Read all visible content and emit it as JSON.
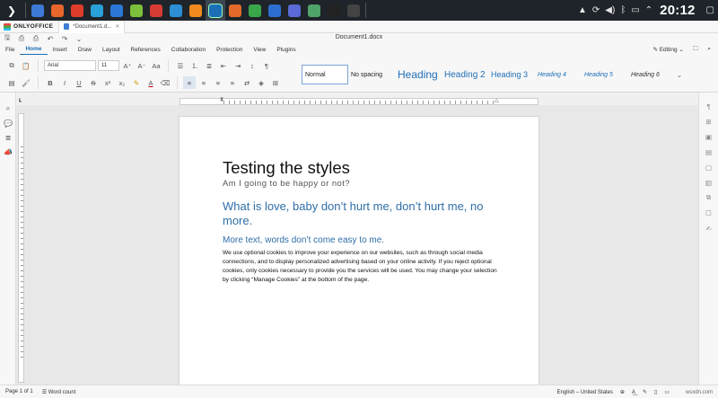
{
  "taskbar": {
    "start_icon": "kde-start-icon",
    "apps": [
      {
        "name": "folder-app",
        "color": "#3d7ad6",
        "active": false
      },
      {
        "name": "firefox-app",
        "color": "#e8652b",
        "active": false
      },
      {
        "name": "brave-app",
        "color": "#e03c2c",
        "active": false
      },
      {
        "name": "edge-app",
        "color": "#2aa0d8",
        "active": false
      },
      {
        "name": "chromium-app",
        "color": "#2b78d6",
        "active": false
      },
      {
        "name": "android-app",
        "color": "#7bbf3a",
        "active": false
      },
      {
        "name": "rednotebook-app",
        "color": "#d83a34",
        "active": false
      },
      {
        "name": "earth-app",
        "color": "#2c8fd6",
        "active": false
      },
      {
        "name": "vlc-app",
        "color": "#f08a1c",
        "active": false
      },
      {
        "name": "layers-app",
        "color": "#1c6fb6",
        "active": true
      },
      {
        "name": "presentation-app",
        "color": "#e2692a",
        "active": false
      },
      {
        "name": "spreadsheet-app",
        "color": "#3aa64a",
        "active": false
      },
      {
        "name": "document-app",
        "color": "#2d6fd0",
        "active": false
      },
      {
        "name": "code-app",
        "color": "#5a6ad6",
        "active": false
      },
      {
        "name": "image-app",
        "color": "#4fa46a",
        "active": false
      },
      {
        "name": "terminal-app",
        "color": "#222",
        "active": false
      },
      {
        "name": "console-app",
        "color": "#444",
        "active": false
      }
    ],
    "clock": "20:12"
  },
  "app": {
    "brand": "ONLYOFFICE",
    "tab_label": "*Document1.d...",
    "doc_title": "Document1.docx"
  },
  "menu": {
    "tabs": [
      "File",
      "Home",
      "Insert",
      "Draw",
      "Layout",
      "References",
      "Collaboration",
      "Protection",
      "View",
      "Plugins"
    ],
    "active": "Home",
    "editing_label": "Editing"
  },
  "toolbar": {
    "font_name": "Arial",
    "font_size": "11",
    "styles": [
      "Normal",
      "No spacing",
      "Heading 1",
      "Heading 2",
      "Heading 3",
      "Heading 4",
      "Heading 5",
      "Heading 6"
    ],
    "style_prefix_visible": "Heading"
  },
  "document": {
    "title": "Testing the styles",
    "subtitle": "Am I going to be happy or not?",
    "heading1": "What is love, baby don’t hurt me, don’t hurt me, no more.",
    "heading2": "More text, words don’t come easy to me.",
    "body": "We use optional cookies to improve your experience on our websites, such as through social media connections, and to display personalized advertising based on your online activity. If you reject optional cookies, only cookies necessary to provide you the services will be used. You may change your selection by clicking “Manage Cookies” at the bottom of the page."
  },
  "status": {
    "page": "Page 1 of 1",
    "word_count": "Word count",
    "language": "English – United States"
  },
  "watermark": "wsxdn.com"
}
